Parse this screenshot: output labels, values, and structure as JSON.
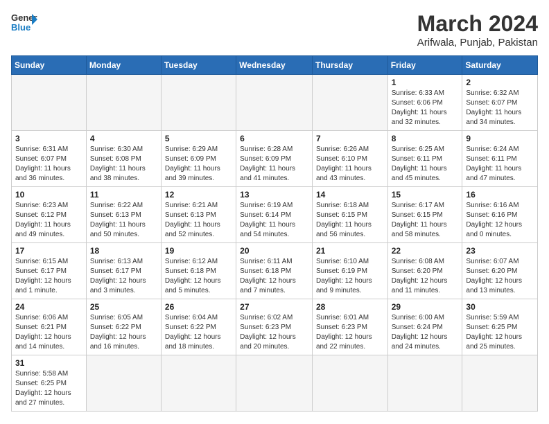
{
  "logo": {
    "general": "General",
    "blue": "Blue"
  },
  "title": "March 2024",
  "location": "Arifwala, Punjab, Pakistan",
  "headers": [
    "Sunday",
    "Monday",
    "Tuesday",
    "Wednesday",
    "Thursday",
    "Friday",
    "Saturday"
  ],
  "weeks": [
    [
      {
        "day": "",
        "info": ""
      },
      {
        "day": "",
        "info": ""
      },
      {
        "day": "",
        "info": ""
      },
      {
        "day": "",
        "info": ""
      },
      {
        "day": "",
        "info": ""
      },
      {
        "day": "1",
        "info": "Sunrise: 6:33 AM\nSunset: 6:06 PM\nDaylight: 11 hours\nand 32 minutes."
      },
      {
        "day": "2",
        "info": "Sunrise: 6:32 AM\nSunset: 6:07 PM\nDaylight: 11 hours\nand 34 minutes."
      }
    ],
    [
      {
        "day": "3",
        "info": "Sunrise: 6:31 AM\nSunset: 6:07 PM\nDaylight: 11 hours\nand 36 minutes."
      },
      {
        "day": "4",
        "info": "Sunrise: 6:30 AM\nSunset: 6:08 PM\nDaylight: 11 hours\nand 38 minutes."
      },
      {
        "day": "5",
        "info": "Sunrise: 6:29 AM\nSunset: 6:09 PM\nDaylight: 11 hours\nand 39 minutes."
      },
      {
        "day": "6",
        "info": "Sunrise: 6:28 AM\nSunset: 6:09 PM\nDaylight: 11 hours\nand 41 minutes."
      },
      {
        "day": "7",
        "info": "Sunrise: 6:26 AM\nSunset: 6:10 PM\nDaylight: 11 hours\nand 43 minutes."
      },
      {
        "day": "8",
        "info": "Sunrise: 6:25 AM\nSunset: 6:11 PM\nDaylight: 11 hours\nand 45 minutes."
      },
      {
        "day": "9",
        "info": "Sunrise: 6:24 AM\nSunset: 6:11 PM\nDaylight: 11 hours\nand 47 minutes."
      }
    ],
    [
      {
        "day": "10",
        "info": "Sunrise: 6:23 AM\nSunset: 6:12 PM\nDaylight: 11 hours\nand 49 minutes."
      },
      {
        "day": "11",
        "info": "Sunrise: 6:22 AM\nSunset: 6:13 PM\nDaylight: 11 hours\nand 50 minutes."
      },
      {
        "day": "12",
        "info": "Sunrise: 6:21 AM\nSunset: 6:13 PM\nDaylight: 11 hours\nand 52 minutes."
      },
      {
        "day": "13",
        "info": "Sunrise: 6:19 AM\nSunset: 6:14 PM\nDaylight: 11 hours\nand 54 minutes."
      },
      {
        "day": "14",
        "info": "Sunrise: 6:18 AM\nSunset: 6:15 PM\nDaylight: 11 hours\nand 56 minutes."
      },
      {
        "day": "15",
        "info": "Sunrise: 6:17 AM\nSunset: 6:15 PM\nDaylight: 11 hours\nand 58 minutes."
      },
      {
        "day": "16",
        "info": "Sunrise: 6:16 AM\nSunset: 6:16 PM\nDaylight: 12 hours\nand 0 minutes."
      }
    ],
    [
      {
        "day": "17",
        "info": "Sunrise: 6:15 AM\nSunset: 6:17 PM\nDaylight: 12 hours\nand 1 minute."
      },
      {
        "day": "18",
        "info": "Sunrise: 6:13 AM\nSunset: 6:17 PM\nDaylight: 12 hours\nand 3 minutes."
      },
      {
        "day": "19",
        "info": "Sunrise: 6:12 AM\nSunset: 6:18 PM\nDaylight: 12 hours\nand 5 minutes."
      },
      {
        "day": "20",
        "info": "Sunrise: 6:11 AM\nSunset: 6:18 PM\nDaylight: 12 hours\nand 7 minutes."
      },
      {
        "day": "21",
        "info": "Sunrise: 6:10 AM\nSunset: 6:19 PM\nDaylight: 12 hours\nand 9 minutes."
      },
      {
        "day": "22",
        "info": "Sunrise: 6:08 AM\nSunset: 6:20 PM\nDaylight: 12 hours\nand 11 minutes."
      },
      {
        "day": "23",
        "info": "Sunrise: 6:07 AM\nSunset: 6:20 PM\nDaylight: 12 hours\nand 13 minutes."
      }
    ],
    [
      {
        "day": "24",
        "info": "Sunrise: 6:06 AM\nSunset: 6:21 PM\nDaylight: 12 hours\nand 14 minutes."
      },
      {
        "day": "25",
        "info": "Sunrise: 6:05 AM\nSunset: 6:22 PM\nDaylight: 12 hours\nand 16 minutes."
      },
      {
        "day": "26",
        "info": "Sunrise: 6:04 AM\nSunset: 6:22 PM\nDaylight: 12 hours\nand 18 minutes."
      },
      {
        "day": "27",
        "info": "Sunrise: 6:02 AM\nSunset: 6:23 PM\nDaylight: 12 hours\nand 20 minutes."
      },
      {
        "day": "28",
        "info": "Sunrise: 6:01 AM\nSunset: 6:23 PM\nDaylight: 12 hours\nand 22 minutes."
      },
      {
        "day": "29",
        "info": "Sunrise: 6:00 AM\nSunset: 6:24 PM\nDaylight: 12 hours\nand 24 minutes."
      },
      {
        "day": "30",
        "info": "Sunrise: 5:59 AM\nSunset: 6:25 PM\nDaylight: 12 hours\nand 25 minutes."
      }
    ],
    [
      {
        "day": "31",
        "info": "Sunrise: 5:58 AM\nSunset: 6:25 PM\nDaylight: 12 hours\nand 27 minutes."
      },
      {
        "day": "",
        "info": ""
      },
      {
        "day": "",
        "info": ""
      },
      {
        "day": "",
        "info": ""
      },
      {
        "day": "",
        "info": ""
      },
      {
        "day": "",
        "info": ""
      },
      {
        "day": "",
        "info": ""
      }
    ]
  ]
}
